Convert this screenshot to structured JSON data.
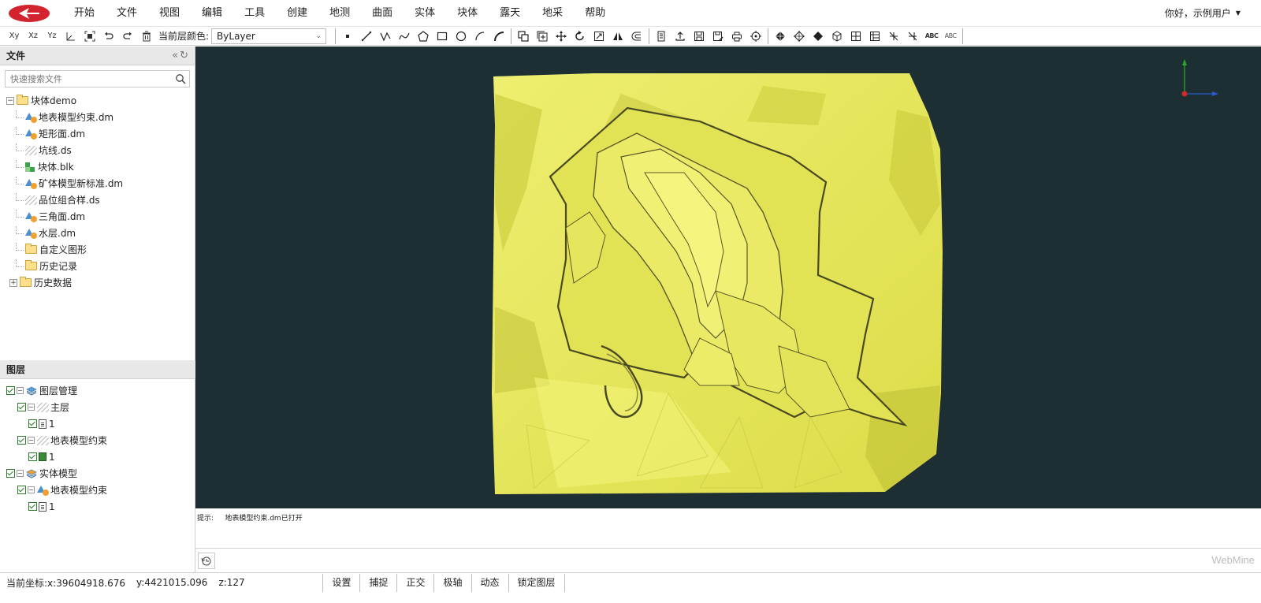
{
  "menu": [
    "开始",
    "文件",
    "视图",
    "编辑",
    "工具",
    "创建",
    "地测",
    "曲面",
    "实体",
    "块体",
    "露天",
    "地采",
    "帮助"
  ],
  "user": {
    "greeting": "你好，示例用户"
  },
  "toolbar": {
    "axis_buttons": [
      "Xy",
      "Xz",
      "Yz"
    ],
    "layer_color_label": "当前层颜色:",
    "layer_color_value": "ByLayer",
    "abc1": "ABC",
    "abc2": "ABC"
  },
  "files_panel": {
    "title": "文件",
    "search_placeholder": "快速搜索文件",
    "root": "块体demo",
    "items": [
      {
        "label": "地表模型约束.dm",
        "type": "dm"
      },
      {
        "label": "矩形面.dm",
        "type": "dm"
      },
      {
        "label": "坑线.ds",
        "type": "ds"
      },
      {
        "label": "块体.blk",
        "type": "blk"
      },
      {
        "label": "矿体模型新标准.dm",
        "type": "dm"
      },
      {
        "label": "品位组合样.ds",
        "type": "ds"
      },
      {
        "label": "三角面.dm",
        "type": "dm"
      },
      {
        "label": "水层.dm",
        "type": "dm"
      },
      {
        "label": "自定义图形",
        "type": "folder"
      },
      {
        "label": "历史记录",
        "type": "folder"
      },
      {
        "label": "历史数据",
        "type": "folder-collapsed"
      }
    ]
  },
  "layers_panel": {
    "title": "图层",
    "tree": [
      {
        "label": "图层管理",
        "level": 0
      },
      {
        "label": "主层",
        "level": 1
      },
      {
        "label": "1",
        "level": 2
      },
      {
        "label": "地表模型约束",
        "level": 1
      },
      {
        "label": "1",
        "level": 2
      },
      {
        "label": "实体模型",
        "level": 0
      },
      {
        "label": "地表模型约束",
        "level": 1
      },
      {
        "label": "1",
        "level": 2
      }
    ]
  },
  "console": {
    "prompt": "提示:",
    "message": "地表模型约束.dm已打开"
  },
  "brand": "WebMine",
  "status": {
    "coord_label": "当前坐标:x:39604918.676",
    "y": "y:4421015.096",
    "z": "z:127",
    "buttons": [
      "设置",
      "捕捉",
      "正交",
      "极轴",
      "动态",
      "锁定图层"
    ]
  },
  "colors": {
    "model_fill": "#e8e65a",
    "viewport_bg": "#1e2f33",
    "check_green": "#2f7a2f"
  }
}
